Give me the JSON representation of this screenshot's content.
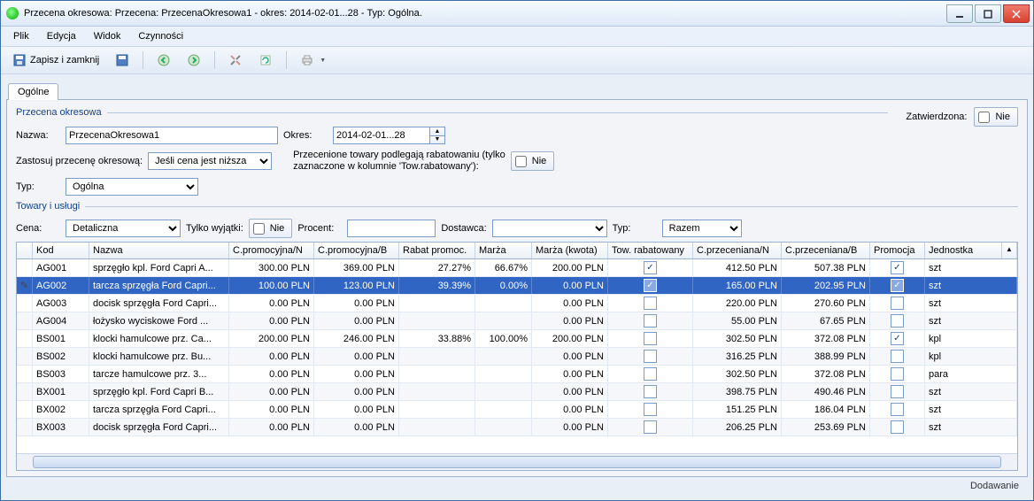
{
  "window": {
    "title": "Przecena okresowa: Przecena: PrzecenaOkresowa1 - okres: 2014-02-01...28 - Typ: Ogólna."
  },
  "menu": {
    "plik": "Plik",
    "edycja": "Edycja",
    "widok": "Widok",
    "czynnosci": "Czynności"
  },
  "toolbar": {
    "save_close": "Zapisz i zamknij"
  },
  "tabs": {
    "ogolne": "Ogólne"
  },
  "group1": {
    "title": "Przecena okresowa"
  },
  "group2": {
    "title": "Towary i usługi"
  },
  "approved": {
    "label": "Zatwierdzona:",
    "value": "Nie"
  },
  "form": {
    "nazwa_label": "Nazwa:",
    "nazwa_value": "PrzecenaOkresowa1",
    "okres_label": "Okres:",
    "okres_value": "2014-02-01...28",
    "zastosuj_label": "Zastosuj przecenę okresową:",
    "zastosuj_value": "Jeśli cena jest niższa",
    "rabat_note_l1": "Przecenione towary podlegają rabatowaniu (tylko",
    "rabat_note_l2": "zaznaczone w kolumnie 'Tow.rabatowany'):",
    "rabat_value": "Nie",
    "typ_label": "Typ:",
    "typ_value": "Ogólna"
  },
  "filter": {
    "cena_label": "Cena:",
    "cena_value": "Detaliczna",
    "wyjatki_label": "Tylko wyjątki:",
    "wyjatki_value": "Nie",
    "procent_label": "Procent:",
    "procent_value": "",
    "dostawca_label": "Dostawca:",
    "dostawca_value": "",
    "typ_label": "Typ:",
    "typ_value": "Razem"
  },
  "columns": {
    "kod": "Kod",
    "nazwa": "Nazwa",
    "cpn": "C.promocyjna/N",
    "cpb": "C.promocyjna/B",
    "rabat": "Rabat promoc.",
    "marza": "Marża",
    "marzak": "Marża (kwota)",
    "tow": "Tow. rabatowany",
    "cprn": "C.przeceniana/N",
    "cprb": "C.przeceniana/B",
    "promo": "Promocja",
    "jedn": "Jednostka"
  },
  "rows": [
    {
      "sel": false,
      "edit": false,
      "kod": "AG001",
      "nazwa": "sprzęgło kpl. Ford Capri A...",
      "cpn": "300.00 PLN",
      "cpb": "369.00 PLN",
      "rabat": "27.27%",
      "marza": "66.67%",
      "marzak": "200.00 PLN",
      "tow": true,
      "cprn": "412.50 PLN",
      "cprb": "507.38 PLN",
      "promo": true,
      "jedn": "szt"
    },
    {
      "sel": true,
      "edit": true,
      "kod": "AG002",
      "nazwa": "tarcza sprzęgła Ford Capri...",
      "cpn": "100.00 PLN",
      "cpb": "123.00 PLN",
      "rabat": "39.39%",
      "marza": "0.00%",
      "marzak": "0.00 PLN",
      "tow": true,
      "cprn": "165.00 PLN",
      "cprb": "202.95 PLN",
      "promo": true,
      "jedn": "szt"
    },
    {
      "sel": false,
      "edit": false,
      "kod": "AG003",
      "nazwa": "docisk sprzęgła Ford Capri...",
      "cpn": "0.00 PLN",
      "cpb": "0.00 PLN",
      "rabat": "",
      "marza": "",
      "marzak": "0.00 PLN",
      "tow": false,
      "cprn": "220.00 PLN",
      "cprb": "270.60 PLN",
      "promo": false,
      "jedn": "szt"
    },
    {
      "sel": false,
      "edit": false,
      "kod": "AG004",
      "nazwa": "łożysko wyciskowe Ford ...",
      "cpn": "0.00 PLN",
      "cpb": "0.00 PLN",
      "rabat": "",
      "marza": "",
      "marzak": "0.00 PLN",
      "tow": false,
      "cprn": "55.00 PLN",
      "cprb": "67.65 PLN",
      "promo": false,
      "jedn": "szt"
    },
    {
      "sel": false,
      "edit": false,
      "kod": "BS001",
      "nazwa": "klocki hamulcowe prz. Ca...",
      "cpn": "200.00 PLN",
      "cpb": "246.00 PLN",
      "rabat": "33.88%",
      "marza": "100.00%",
      "marzak": "200.00 PLN",
      "tow": false,
      "cprn": "302.50 PLN",
      "cprb": "372.08 PLN",
      "promo": true,
      "jedn": "kpl"
    },
    {
      "sel": false,
      "edit": false,
      "kod": "BS002",
      "nazwa": "klocki hamulcowe prz. Bu...",
      "cpn": "0.00 PLN",
      "cpb": "0.00 PLN",
      "rabat": "",
      "marza": "",
      "marzak": "0.00 PLN",
      "tow": false,
      "cprn": "316.25 PLN",
      "cprb": "388.99 PLN",
      "promo": false,
      "jedn": "kpl"
    },
    {
      "sel": false,
      "edit": false,
      "kod": "BS003",
      "nazwa": "tarcze hamulcowe prz. 3...",
      "cpn": "0.00 PLN",
      "cpb": "0.00 PLN",
      "rabat": "",
      "marza": "",
      "marzak": "0.00 PLN",
      "tow": false,
      "cprn": "302.50 PLN",
      "cprb": "372.08 PLN",
      "promo": false,
      "jedn": "para"
    },
    {
      "sel": false,
      "edit": false,
      "kod": "BX001",
      "nazwa": "sprzęgło kpl. Ford Capri B...",
      "cpn": "0.00 PLN",
      "cpb": "0.00 PLN",
      "rabat": "",
      "marza": "",
      "marzak": "0.00 PLN",
      "tow": false,
      "cprn": "398.75 PLN",
      "cprb": "490.46 PLN",
      "promo": false,
      "jedn": "szt"
    },
    {
      "sel": false,
      "edit": false,
      "kod": "BX002",
      "nazwa": "tarcza sprzęgła Ford Capri...",
      "cpn": "0.00 PLN",
      "cpb": "0.00 PLN",
      "rabat": "",
      "marza": "",
      "marzak": "0.00 PLN",
      "tow": false,
      "cprn": "151.25 PLN",
      "cprb": "186.04 PLN",
      "promo": false,
      "jedn": "szt"
    },
    {
      "sel": false,
      "edit": false,
      "kod": "BX003",
      "nazwa": "docisk sprzęgła Ford Capri...",
      "cpn": "0.00 PLN",
      "cpb": "0.00 PLN",
      "rabat": "",
      "marza": "",
      "marzak": "0.00 PLN",
      "tow": false,
      "cprn": "206.25 PLN",
      "cprb": "253.69 PLN",
      "promo": false,
      "jedn": "szt"
    }
  ],
  "status": {
    "text": "Dodawanie"
  }
}
